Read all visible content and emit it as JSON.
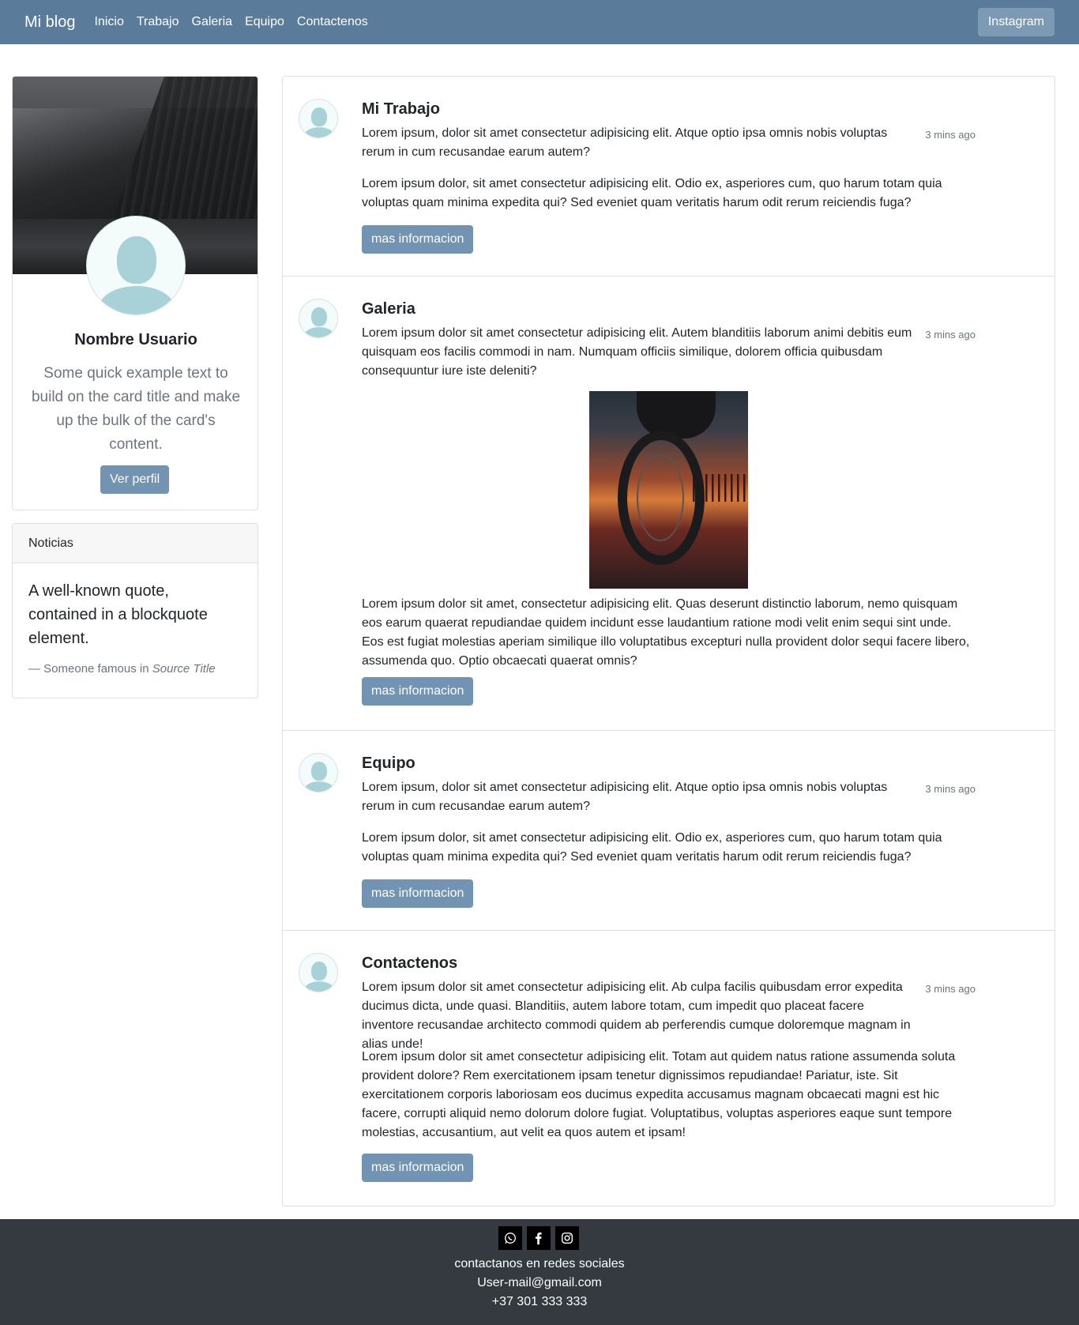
{
  "navbar": {
    "brand": "Mi blog",
    "links": [
      "Inicio",
      "Trabajo",
      "Galeria",
      "Equipo",
      "Contactenos"
    ],
    "instagram_button": "Instagram"
  },
  "profile": {
    "name": "Nombre Usuario",
    "text": "Some quick example text to build on the card title and make up the bulk of the card's content.",
    "button": "Ver perfil"
  },
  "news": {
    "header": "Noticias",
    "quote": "A well-known quote, contained in a blockquote element.",
    "footer_prefix": "— Someone famous in ",
    "footer_source": "Source Title"
  },
  "posts": [
    {
      "title": "Mi Trabajo",
      "time": "3 mins ago",
      "p1": "Lorem ipsum, dolor sit amet consectetur adipisicing elit. Atque optio ipsa omnis nobis voluptas rerum in cum recusandae earum autem?",
      "p2": "Lorem ipsum dolor, sit amet consectetur adipisicing elit. Odio ex, asperiores cum, quo harum totam quia voluptas quam minima expedita qui? Sed eveniet quam veritatis harum odit rerum reiciendis fuga?",
      "button": "mas informacion"
    },
    {
      "title": "Galeria",
      "time": "3 mins ago",
      "p1": "Lorem ipsum dolor sit amet consectetur adipisicing elit. Autem blanditiis laborum animi debitis eum quisquam eos facilis commodi in nam. Numquam officiis similique, dolorem officia quibusdam consequuntur iure iste deleniti?",
      "p2": "Lorem ipsum dolor sit amet, consectetur adipisicing elit. Quas deserunt distinctio laborum, nemo quisquam eos earum quaerat repudiandae quidem incidunt esse laudantium ratione modi velit enim sequi sint unde. Eos est fugiat molestias aperiam similique illo voluptatibus excepturi nulla provident dolor sequi facere libero, assumenda quo. Optio obcaecati quaerat omnis?",
      "button": "mas informacion"
    },
    {
      "title": "Equipo",
      "time": "3 mins ago",
      "p1": "Lorem ipsum, dolor sit amet consectetur adipisicing elit. Atque optio ipsa omnis nobis voluptas rerum in cum recusandae earum autem?",
      "p2": "Lorem ipsum dolor, sit amet consectetur adipisicing elit. Odio ex, asperiores cum, quo harum totam quia voluptas quam minima expedita qui? Sed eveniet quam veritatis harum odit rerum reiciendis fuga?",
      "button": "mas informacion"
    },
    {
      "title": "Contactenos",
      "time": "3 mins ago",
      "p1": "Lorem ipsum dolor sit amet consectetur adipisicing elit. Ab culpa facilis quibusdam error expedita ducimus dicta, unde quasi. Blanditiis, autem labore totam, cum impedit quo placeat facere inventore recusandae architecto commodi quidem ab perferendis cumque doloremque magnam in alias unde!",
      "p2": "Lorem ipsum dolor sit amet consectetur adipisicing elit. Totam aut quidem natus ratione assumenda soluta provident dolore? Rem exercitationem ipsam tenetur dignissimos repudiandae! Pariatur, iste. Sit exercitationem corporis laboriosam eos ducimus expedita accusamus magnam obcaecati magni est hic facere, corrupti aliquid nemo dolorum dolore fugiat. Voluptatibus, voluptas asperiores eaque sunt tempore molestias, accusantium, aut velit ea quos autem et ipsam!",
      "button": "mas informacion"
    }
  ],
  "footer": {
    "social_icons": [
      "whatsapp-icon",
      "facebook-icon",
      "instagram-icon"
    ],
    "line1": "contactanos en redes sociales",
    "line2": "User-mail@gmail.com",
    "line3": "+37 301 333 333"
  },
  "colors": {
    "navbar": "#5a7b9a",
    "button": "#7393b2",
    "footer": "#343a40"
  }
}
